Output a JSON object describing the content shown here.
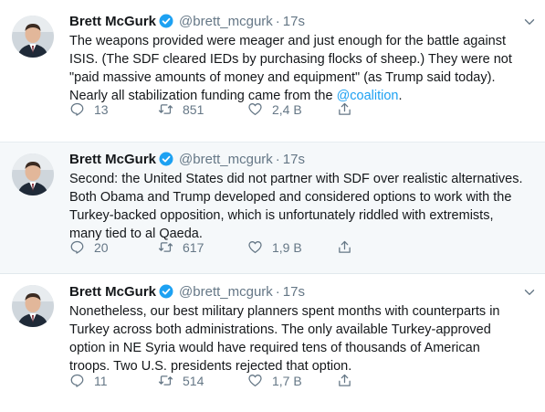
{
  "colors": {
    "accent": "#1da1f2",
    "text": "#14171a",
    "secondary": "#657786",
    "border": "#e6ecf0",
    "highlight_bg": "#f5f8fa"
  },
  "tweets": [
    {
      "name": "Brett McGurk",
      "handle": "@brett_mcgurk",
      "dot": "·",
      "time": "17s",
      "verified_icon": "verified-badge-icon",
      "lines": [
        "The weapons provided were meager and just enough for the battle against",
        "ISIS. (The SDF cleared IEDs by purchasing flocks of sheep.) They were not",
        "\"paid massive amounts of money and equipment\" (as Trump said today).",
        "Nearly all stabilization funding came from the "
      ],
      "mention": "@coalition",
      "mention_tail": ".",
      "replies": "13",
      "retweets": "851",
      "likes": "2,4 B"
    },
    {
      "name": "Brett McGurk",
      "handle": "@brett_mcgurk",
      "dot": "·",
      "time": "17s",
      "verified_icon": "verified-badge-icon",
      "lines": [
        "Second: the United States did not partner with SDF over realistic alternatives.",
        "Both Obama and Trump developed and considered options to work with the",
        "Turkey-backed opposition, which is unfortunately riddled with extremists,",
        "many tied to al Qaeda."
      ],
      "replies": "20",
      "retweets": "617",
      "likes": "1,9 B"
    },
    {
      "name": "Brett McGurk",
      "handle": "@brett_mcgurk",
      "dot": "·",
      "time": "17s",
      "verified_icon": "verified-badge-icon",
      "lines": [
        "Nonetheless, our best military planners spent months with counterparts in",
        "Turkey across both administrations. The only available Turkey-approved",
        "option in NE Syria would have required tens of thousands of American",
        "troops. Two U.S. presidents rejected that option."
      ],
      "replies": "11",
      "retweets": "514",
      "likes": "1,7 B"
    }
  ]
}
